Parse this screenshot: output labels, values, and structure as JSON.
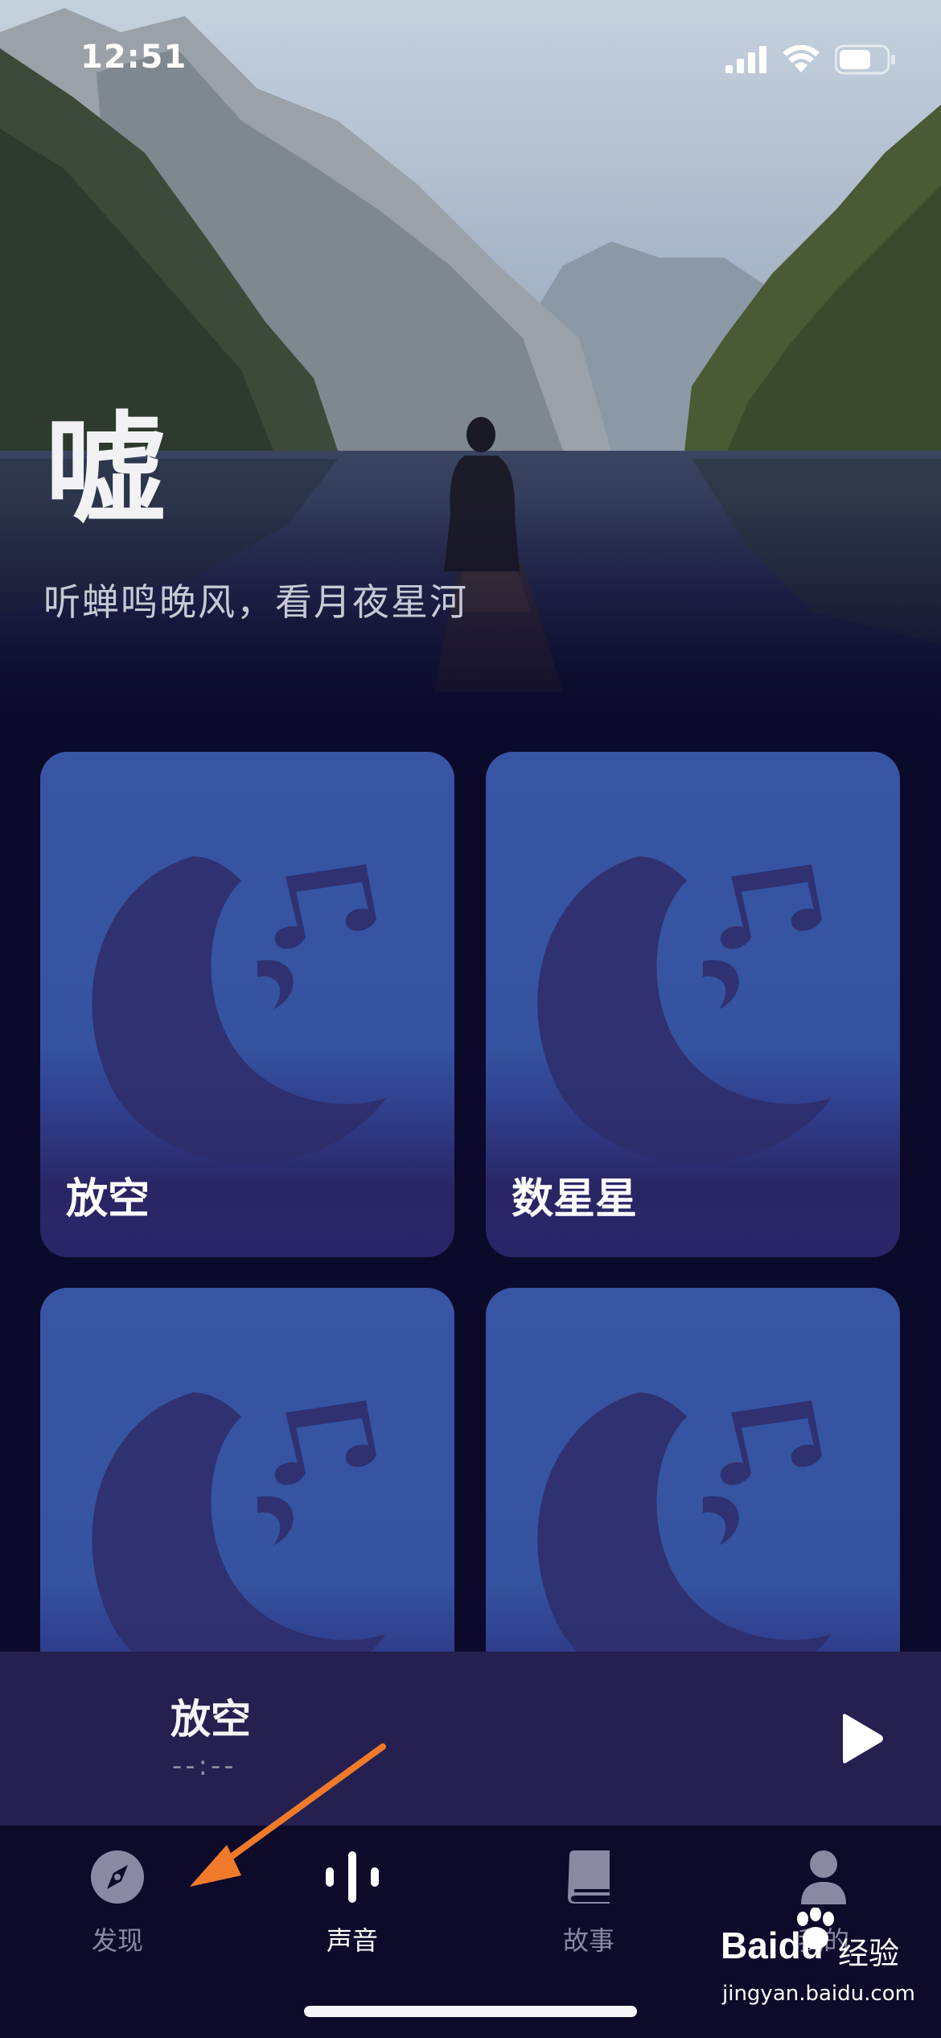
{
  "status_bar": {
    "time": "12:51",
    "icons": [
      "signal-icon",
      "wifi-icon",
      "battery-icon"
    ]
  },
  "hero": {
    "title": "嘘",
    "subtitle": "听蝉鸣晚风，看月夜星河"
  },
  "cards": [
    {
      "label": "放空",
      "icon": "moon-music-icon"
    },
    {
      "label": "数星星",
      "icon": "moon-music-icon"
    },
    {
      "label": "",
      "icon": "moon-music-icon"
    },
    {
      "label": "",
      "icon": "moon-music-icon"
    }
  ],
  "mini_player": {
    "title": "放空",
    "time": "--:--",
    "play_icon": "play-icon"
  },
  "tabs": [
    {
      "label": "发现",
      "icon": "compass-icon",
      "active": false
    },
    {
      "label": "声音",
      "icon": "sound-wave-icon",
      "active": true
    },
    {
      "label": "故事",
      "icon": "book-icon",
      "active": false
    },
    {
      "label": "我的",
      "icon": "user-icon",
      "active": false
    }
  ],
  "watermark": {
    "brand": "Baidu",
    "brand_cn": "经验",
    "url": "jingyan.baidu.com"
  },
  "colors": {
    "background": "#0c0a2a",
    "card": "#3755a3",
    "card_bottom": "#2a2568",
    "mini_player": "#25204f",
    "annotation_arrow": "#f07a2a",
    "tab_inactive": "#8a88a3"
  }
}
